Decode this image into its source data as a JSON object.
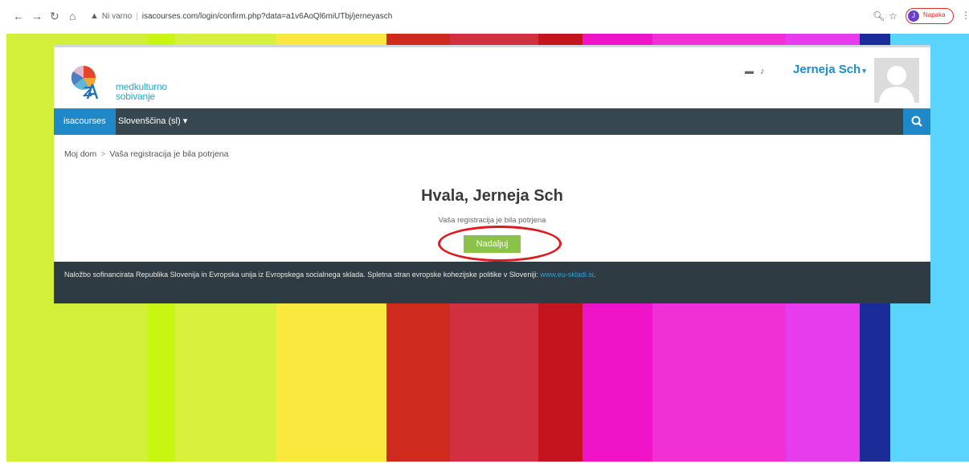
{
  "browser": {
    "security_label": "Ni varno",
    "url": "isacourses.com/login/confirm.php?data=a1v6AoQl6miUTbj/jerneyasch",
    "profile_initial": "J",
    "profile_label": "Napaka"
  },
  "site": {
    "logo_line1": "medkulturno",
    "logo_line2": "sobivanje"
  },
  "header": {
    "user_name": "Jerneja Sch"
  },
  "navbar": {
    "home_label": "isacourses",
    "language_label": "Slovenščina (sl)"
  },
  "breadcrumb": {
    "items": [
      "Moj dom",
      "Vaša registracija je bila potrjena"
    ]
  },
  "main": {
    "heading": "Hvala, Jerneja Sch",
    "message": "Vaša registracija je bila potrjena",
    "continue_label": "Nadaljuj"
  },
  "footer": {
    "text": "Naložbo sofinancirata Republika Slovenija in Evropska unija iz Evropskega socialnega sklada. Spletna stran evropske kohezijske politike v Sloveniji:",
    "link_text": "www.eu-skladi.si",
    "suffix": "."
  },
  "colors": {
    "accent": "#1e88c9",
    "button": "#8bc34a",
    "annotation": "#e0191f",
    "navbar": "#37474f",
    "footer": "#2f3b43"
  },
  "background_stripes": [
    "#d4ef3a",
    "#c8f512",
    "#d8f13c",
    "#fbe83e",
    "#cf2a1e",
    "#d03040",
    "#c4141e",
    "#ef14c8",
    "#f02fd4",
    "#e63cee",
    "#1b2c98",
    "#5ad3fd"
  ]
}
